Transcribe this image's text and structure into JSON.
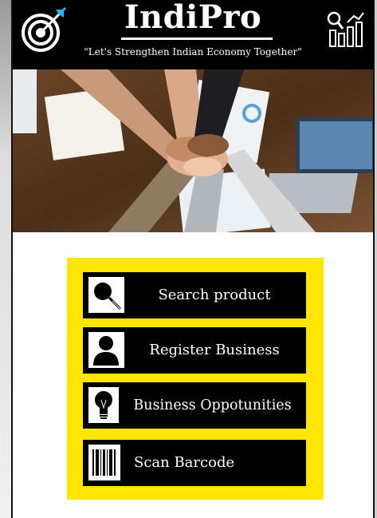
{
  "header": {
    "brand": "IndiPro",
    "tagline": "\"Let's Strengthen Indian Economy Together\"",
    "left_icon": "target-icon",
    "right_icon": "growth-chart-icon"
  },
  "hero": {
    "description_icon": "team-hands-photo"
  },
  "menu": {
    "background_color": "#ffe600",
    "items": [
      {
        "label": "Search product",
        "icon": "search-icon"
      },
      {
        "label": "Register Business",
        "icon": "user-icon"
      },
      {
        "label": "Business Oppotunities",
        "icon": "lightbulb-icon"
      },
      {
        "label": "Scan Barcode",
        "icon": "barcode-icon"
      }
    ]
  }
}
